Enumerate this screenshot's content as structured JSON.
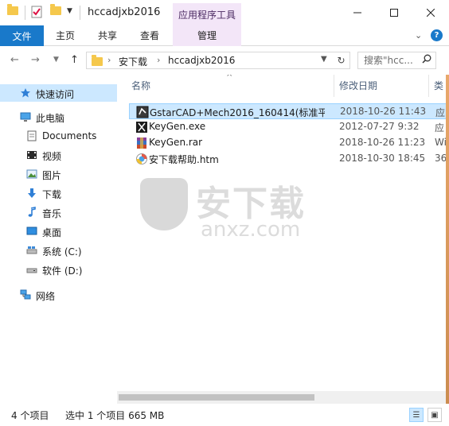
{
  "window": {
    "title": "hccadjxb2016",
    "context_tab_header": "应用程序工具"
  },
  "ribbon": {
    "tabs": {
      "file": "文件",
      "home": "主页",
      "share": "共享",
      "view": "查看",
      "manage": "管理"
    },
    "help_glyph": "?"
  },
  "address": {
    "crumbs": [
      "安下载",
      "hccadjxb2016"
    ],
    "search_placeholder": "搜索\"hcc..."
  },
  "nav": {
    "quick_access": "快速访问",
    "this_pc": "此电脑",
    "items": [
      "Documents",
      "视频",
      "图片",
      "下载",
      "音乐",
      "桌面",
      "系统 (C:)",
      "软件 (D:)"
    ],
    "network": "网络"
  },
  "columns": {
    "name": "名称",
    "date": "修改日期",
    "type": "类"
  },
  "files": [
    {
      "name": "GstarCAD+Mech2016_160414(标准平...",
      "date": "2018-10-26 11:43",
      "type": "应",
      "icon": "gstarcad-icon",
      "selected": true
    },
    {
      "name": "KeyGen.exe",
      "date": "2012-07-27 9:32",
      "type": "应",
      "icon": "exe-icon",
      "selected": false
    },
    {
      "name": "KeyGen.rar",
      "date": "2018-10-26 11:23",
      "type": "Wi",
      "icon": "rar-icon",
      "selected": false
    },
    {
      "name": "安下载帮助.htm",
      "date": "2018-10-30 18:45",
      "type": "36",
      "icon": "htm-icon",
      "selected": false
    }
  ],
  "watermark": {
    "text": "安下载",
    "sub": "anxz.com"
  },
  "status": {
    "count": "4 个项目",
    "selection": "选中 1 个项目  665 MB"
  },
  "colors": {
    "accent": "#1979ca",
    "selection": "#cce8ff",
    "context_tab": "#f3e6f8"
  }
}
